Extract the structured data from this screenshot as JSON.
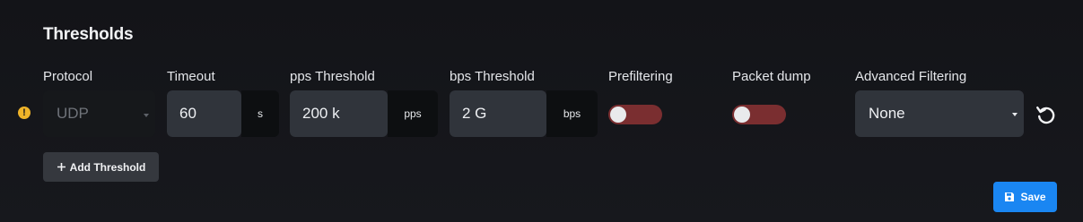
{
  "section": {
    "title": "Thresholds"
  },
  "columns": {
    "protocol": "Protocol",
    "timeout": "Timeout",
    "pps": "pps Threshold",
    "bps": "bps Threshold",
    "prefiltering": "Prefiltering",
    "packet_dump": "Packet dump",
    "advanced_filtering": "Advanced Filtering"
  },
  "row": {
    "warning_icon": "exclamation-icon",
    "warning_glyph": "!",
    "protocol_value": "UDP",
    "timeout_value": "60",
    "timeout_unit": "s",
    "pps_value": "200 k",
    "pps_unit": "pps",
    "bps_value": "2 G",
    "bps_unit": "bps",
    "prefiltering_on": false,
    "packet_dump_on": false,
    "advanced_filtering_value": "None",
    "reset_icon": "reset-icon"
  },
  "actions": {
    "add_threshold_label": "Add Threshold",
    "save_label": "Save"
  },
  "colors": {
    "accent": "#1a86f2",
    "warning": "#f0b429",
    "toggle_off": "#7a2e30"
  }
}
